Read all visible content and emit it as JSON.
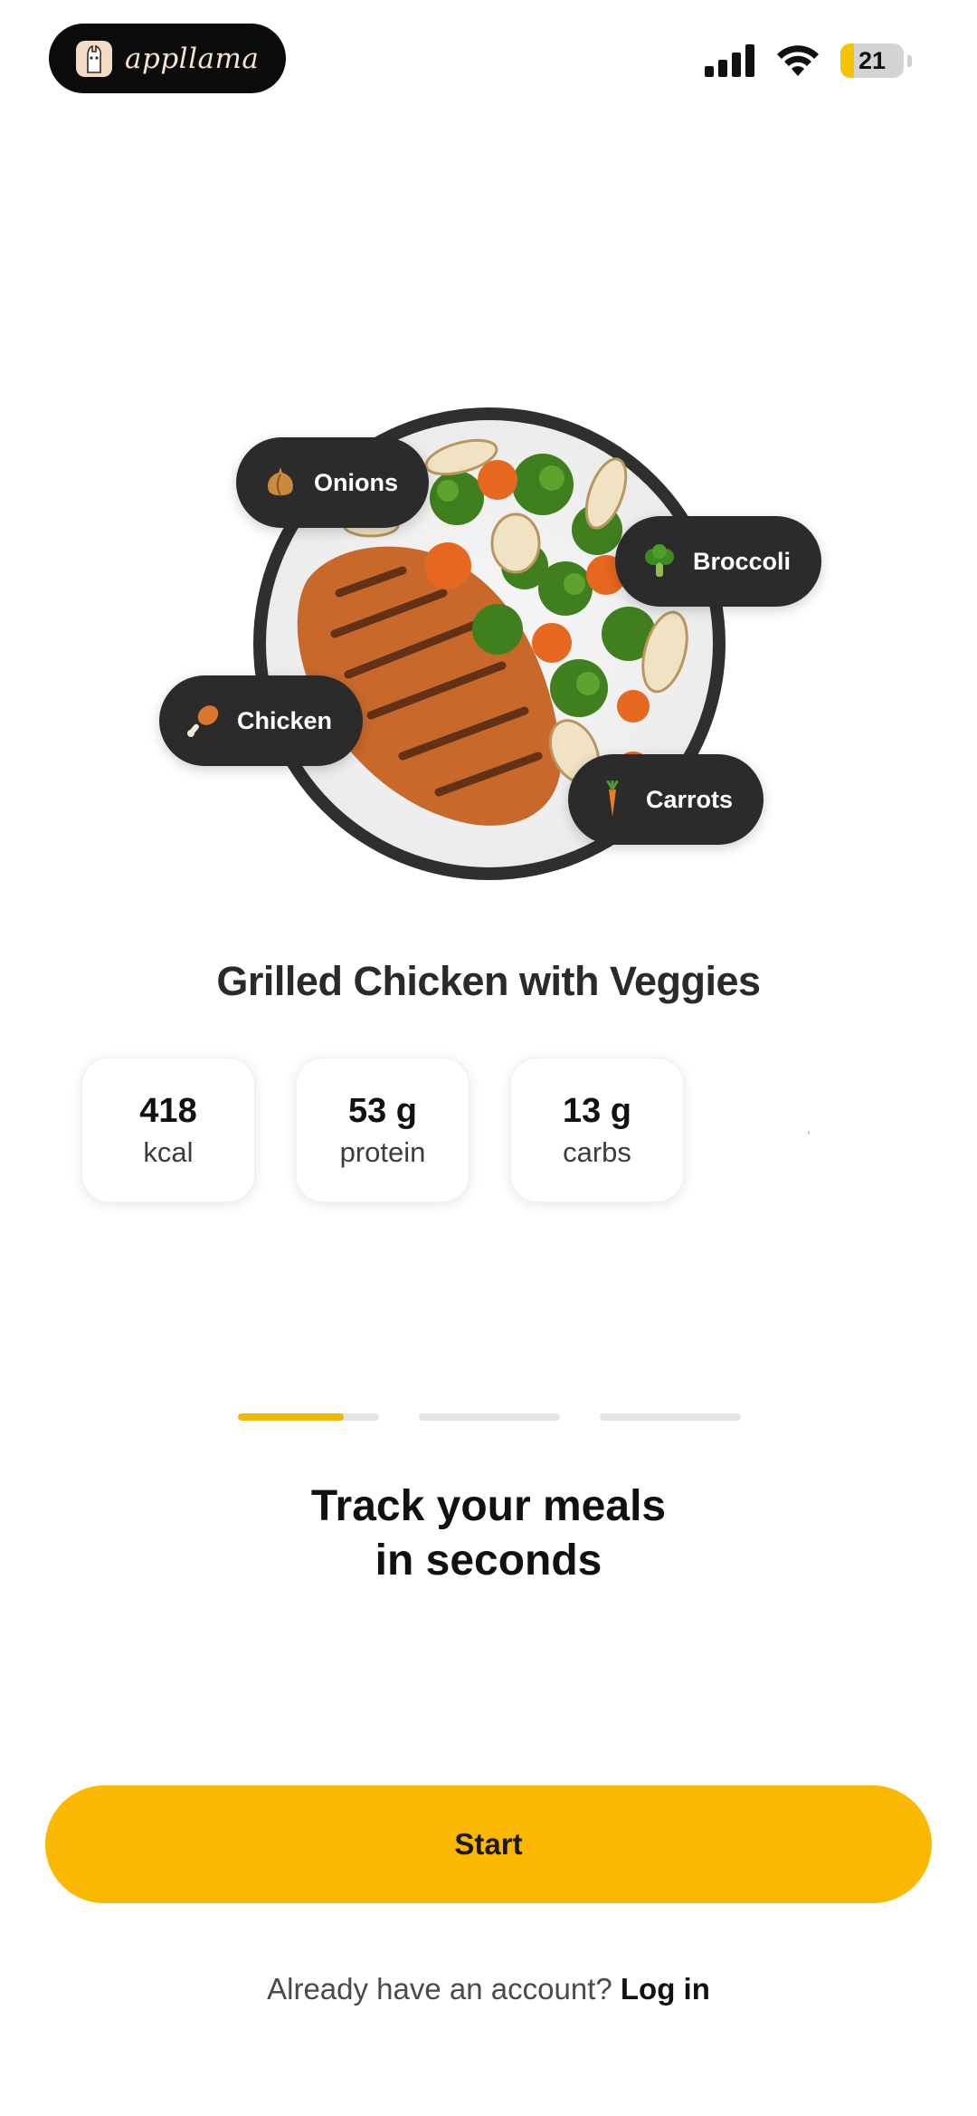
{
  "status_bar": {
    "brand_name": "appllama",
    "battery_level": "21",
    "battery_fraction": 0.21,
    "icons": [
      "signal-icon",
      "wifi-icon",
      "battery-icon"
    ]
  },
  "meal": {
    "title": "Grilled Chicken with Veggies",
    "ingredients": [
      {
        "label": "Onions",
        "icon": "onion-icon"
      },
      {
        "label": "Broccoli",
        "icon": "broccoli-icon"
      },
      {
        "label": "Chicken",
        "icon": "drumstick-icon"
      },
      {
        "label": "Carrots",
        "icon": "carrot-icon"
      }
    ],
    "macros": [
      {
        "value": "418",
        "unit": "kcal"
      },
      {
        "value": "53 g",
        "unit": "protein"
      },
      {
        "value": "13 g",
        "unit": "carbs"
      }
    ]
  },
  "onboarding": {
    "progress": [
      0.75,
      0,
      0
    ],
    "headline_line1": "Track your meals",
    "headline_line2": "in seconds",
    "start_label": "Start",
    "login_prompt": "Already have an account?",
    "login_link": "Log in"
  },
  "colors": {
    "accent": "#FBB800",
    "progress_active": "#F3B700",
    "tag_background": "#2B2B2B"
  }
}
